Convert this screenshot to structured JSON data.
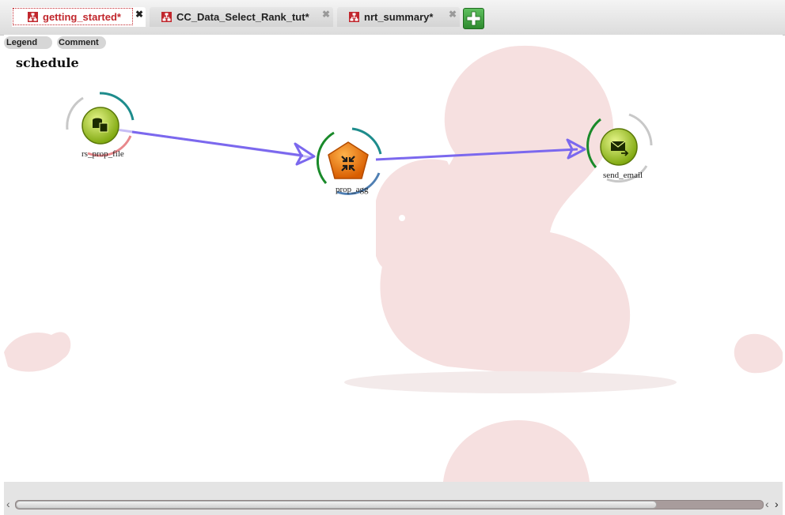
{
  "tabs": [
    {
      "label": "getting_started*",
      "active": true
    },
    {
      "label": "CC_Data_Select_Rank_tut*",
      "active": false
    },
    {
      "label": "nrt_summary*",
      "active": false
    }
  ],
  "toolbar": {
    "legend_label": "Legend",
    "comment_label": "Comment"
  },
  "diagram": {
    "title": "schedule",
    "nodes": [
      {
        "label": "rs_prop_file",
        "icon": "database-icon"
      },
      {
        "label": "prop_agg",
        "icon": "aggregate-icon"
      },
      {
        "label": "send_email",
        "icon": "mail-icon"
      }
    ]
  },
  "colors": {
    "accent": "#c1272d",
    "edge": "#7b68ee",
    "watermark": "#f6e0e0",
    "node_green": "#a8c81e",
    "node_orange": "#e8730f"
  }
}
